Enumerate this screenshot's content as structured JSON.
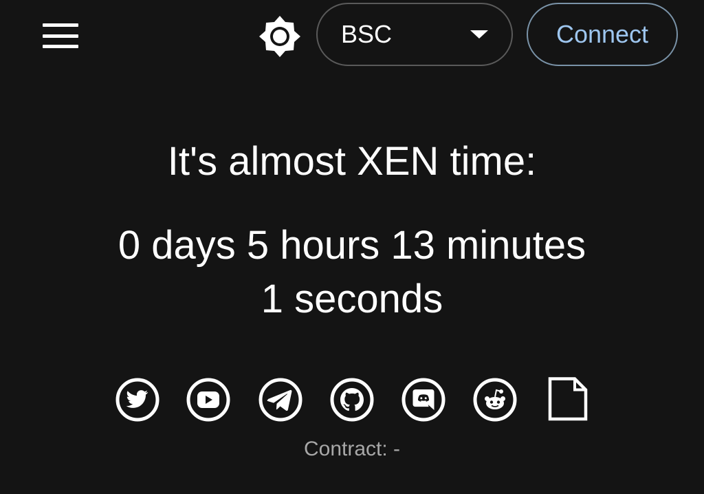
{
  "header": {
    "menu_icon": "hamburger-menu-icon",
    "theme_icon": "brightness-icon",
    "chain_select": {
      "value": "BSC",
      "icon": "caret-down-icon"
    },
    "connect_label": "Connect"
  },
  "main": {
    "headline": "It's almost XEN time:",
    "countdown_line1": "0 days 5 hours 13 minutes",
    "countdown_line2": "1 seconds"
  },
  "socials": [
    {
      "icon": "twitter-icon"
    },
    {
      "icon": "youtube-icon"
    },
    {
      "icon": "telegram-icon"
    },
    {
      "icon": "github-icon"
    },
    {
      "icon": "discord-icon"
    },
    {
      "icon": "reddit-icon"
    },
    {
      "icon": "document-icon"
    }
  ],
  "footer": {
    "contract_label": "Contract: -"
  },
  "colors": {
    "background": "#141414",
    "connect_text": "#9ec6ef",
    "connect_border": "#7a93a8",
    "muted_text": "#a8a8a8"
  }
}
